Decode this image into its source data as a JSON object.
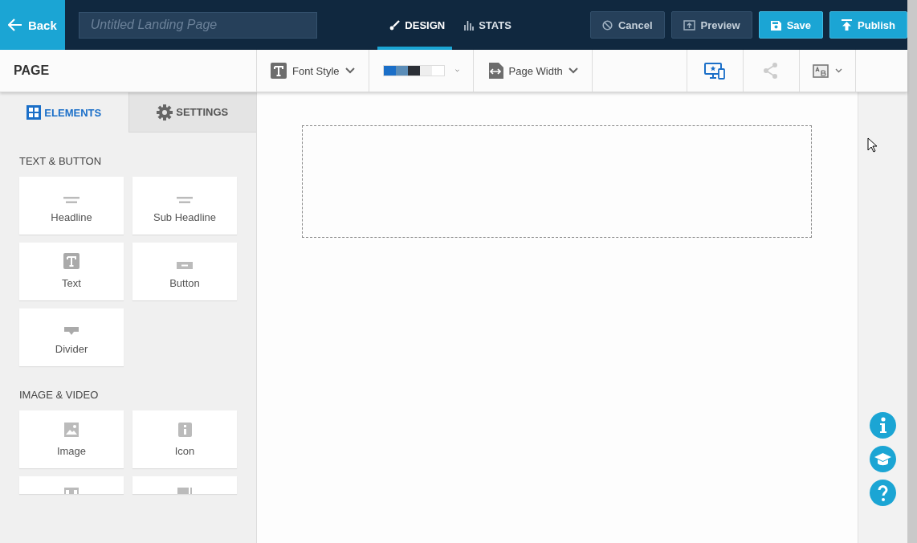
{
  "topbar": {
    "back": "Back",
    "title_field": {
      "placeholder": "Untitled Landing Page"
    },
    "tabs": [
      {
        "label": "DESIGN",
        "selected": true
      },
      {
        "label": "STATS",
        "selected": false
      }
    ],
    "buttons": [
      {
        "label": "Cancel",
        "kind": "cancel"
      },
      {
        "label": "Preview",
        "kind": "preview"
      },
      {
        "label": "Save",
        "kind": "save"
      },
      {
        "label": "Publish",
        "kind": "publish"
      }
    ]
  },
  "toolbar": {
    "section": "PAGE",
    "font_style": "Font Style",
    "swatches": [
      {
        "color": "#1b6fc8"
      },
      {
        "color": "#5b8db8"
      },
      {
        "color": "#2b2f36"
      },
      {
        "color": "#eeeeee"
      },
      {
        "color": "#ffffff"
      }
    ],
    "page_width": "Page Width"
  },
  "sidebar": {
    "tabs": [
      {
        "label": "ELEMENTS",
        "selected": true
      },
      {
        "label": "SETTINGS",
        "selected": false
      }
    ],
    "sections": [
      {
        "title": "TEXT & BUTTON",
        "tiles": [
          {
            "label": "Headline",
            "kind": "headline"
          },
          {
            "label": "Sub Headline",
            "kind": "headline"
          },
          {
            "label": "Text",
            "kind": "text"
          },
          {
            "label": "Button",
            "kind": "button"
          },
          {
            "label": "Divider",
            "kind": "divider"
          }
        ]
      },
      {
        "title": "IMAGE & VIDEO",
        "tiles": [
          {
            "label": "Image",
            "kind": "image"
          },
          {
            "label": "Icon",
            "kind": "icon"
          }
        ]
      }
    ]
  }
}
